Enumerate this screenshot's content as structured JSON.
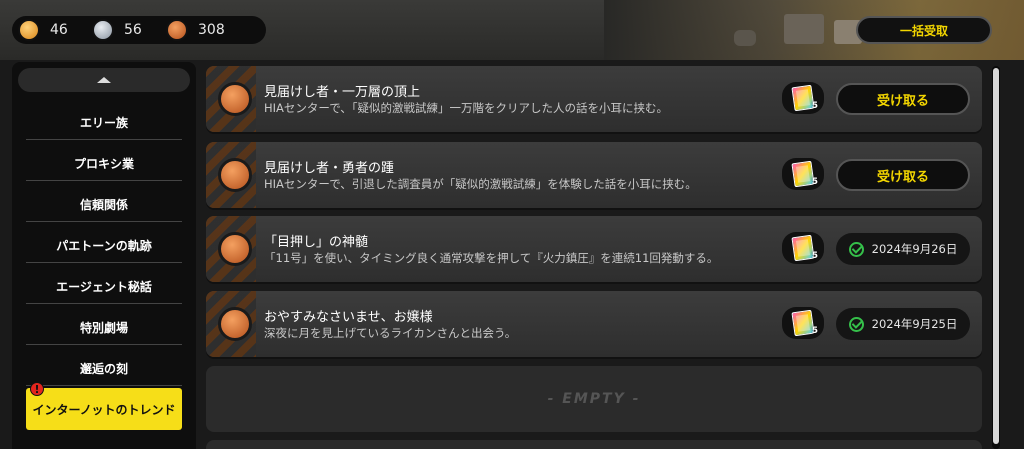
{
  "currencies": [
    {
      "icon": "gold-medal-icon",
      "value": "46"
    },
    {
      "icon": "silver-medal-icon",
      "value": "56"
    },
    {
      "icon": "bronze-medal-icon",
      "value": "308"
    }
  ],
  "claim_all_label": "一括受取",
  "sidebar": {
    "items": [
      {
        "label": "エリー族"
      },
      {
        "label": "プロキシ業"
      },
      {
        "label": "信頼関係"
      },
      {
        "label": "パエトーンの軌跡"
      },
      {
        "label": "エージェント秘話"
      },
      {
        "label": "特別劇場"
      },
      {
        "label": "邂逅の刻"
      },
      {
        "label": "インターノットのトレンド",
        "active": true,
        "alert": "!"
      }
    ]
  },
  "achievements": [
    {
      "title": "見届けし者・一万層の頂上",
      "description": "HIAセンターで、「疑似的激戦試練」一万階をクリアした人の話を小耳に挟む。",
      "reward_qty": "5",
      "action_label": "受け取る"
    },
    {
      "title": "見届けし者・勇者の踵",
      "description": "HIAセンターで、引退した調査員が「疑似的激戦試練」を体験した話を小耳に挟む。",
      "reward_qty": "5",
      "action_label": "受け取る"
    },
    {
      "title": "「目押し」の神髄",
      "description": "「11号」を使い、タイミング良く通常攻撃を押して『火力鎮圧』を連続11回発動する。",
      "reward_qty": "5",
      "completed_date": "2024年9月26日"
    },
    {
      "title": "おやすみなさいませ、お嬢様",
      "description": "深夜に月を見上げているライカンさんと出会う。",
      "reward_qty": "5",
      "completed_date": "2024年9月25日"
    }
  ],
  "empty_label": "- EMPTY -",
  "colors": {
    "accent_yellow": "#f6de18",
    "claim_text": "#f3d600",
    "check_green": "#35c04a"
  }
}
